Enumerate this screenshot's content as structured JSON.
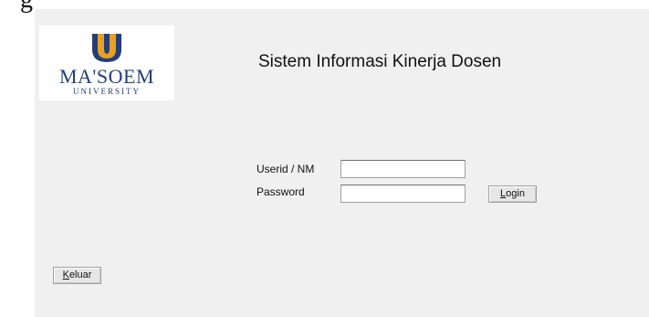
{
  "top_fragment": "g",
  "logo": {
    "name": "MA'SOEM",
    "subtitle": "UNIVERSITY",
    "colors": {
      "navy": "#253d78",
      "gold": "#e8a020"
    }
  },
  "title": "Sistem Informasi Kinerja Dosen",
  "form": {
    "userid_label": "Userid / NM",
    "userid_value": "",
    "password_label": "Password",
    "password_value": ""
  },
  "buttons": {
    "login": {
      "mnemonic": "L",
      "rest": "ogin"
    },
    "exit": {
      "mnemonic": "K",
      "rest": "eluar"
    }
  }
}
